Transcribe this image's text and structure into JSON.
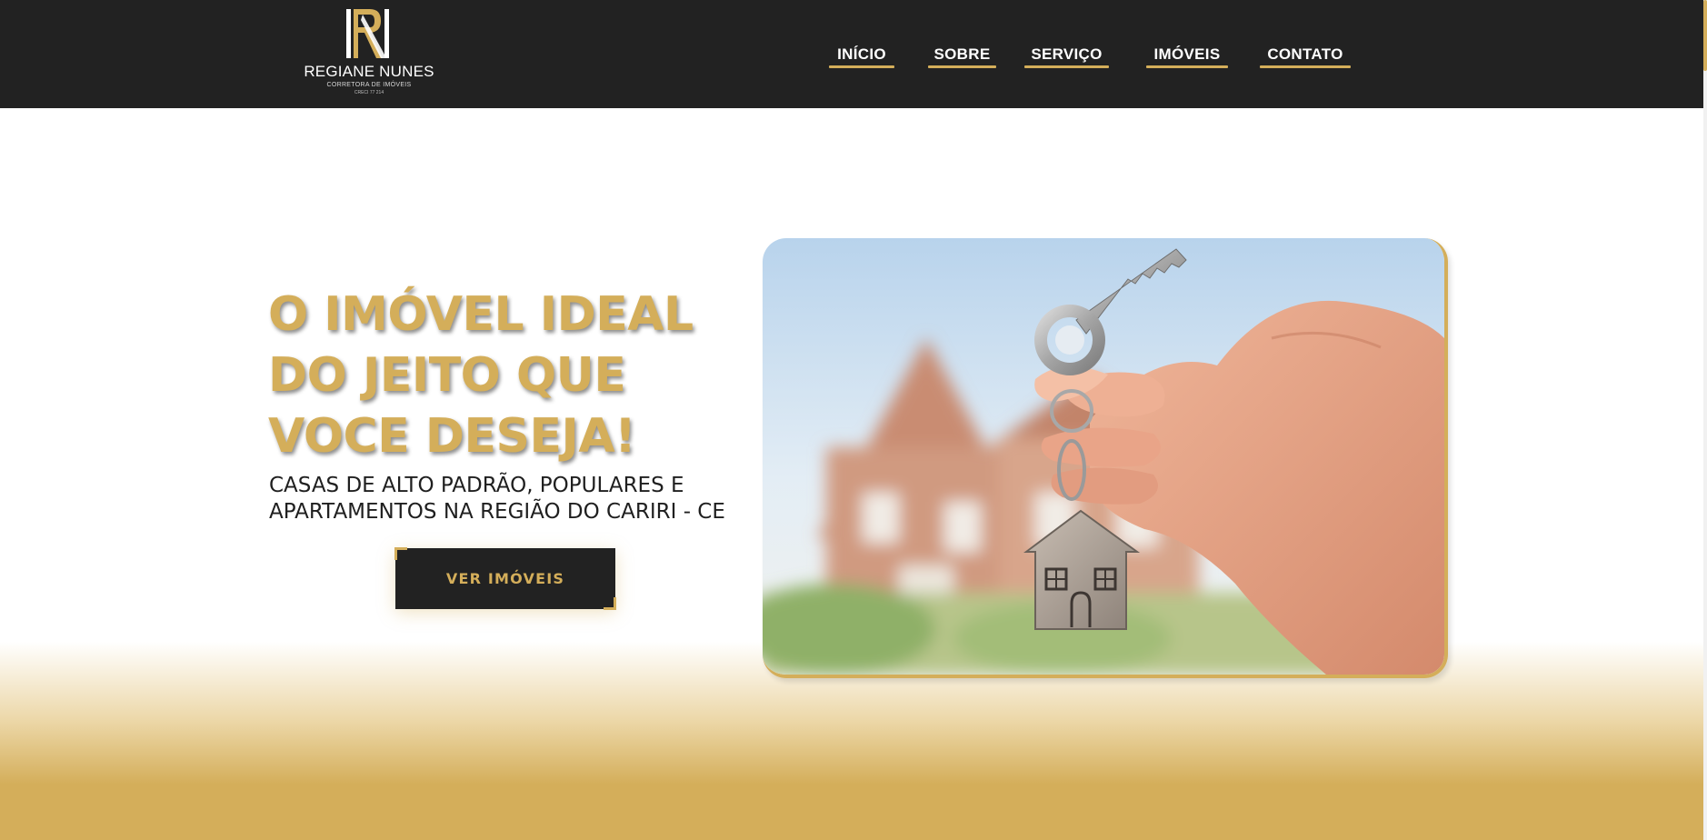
{
  "brand": {
    "name": "REGIANE NUNES",
    "subtitle": "CORRETORA DE IMÓVEIS",
    "creci": "CRECI 77 214"
  },
  "nav": {
    "items": [
      {
        "label": "INÍCIO"
      },
      {
        "label": "SOBRE"
      },
      {
        "label": "SERVIÇO"
      },
      {
        "label": "IMÓVEIS"
      },
      {
        "label": "CONTATO"
      }
    ]
  },
  "hero": {
    "title_lines": [
      "O IMÓVEL IDEAL",
      "DO JEITO QUE",
      "VOCE DESEJA!"
    ],
    "subtitle_lines": [
      "CASAS DE ALTO PADRÃO, POPULARES E",
      "APARTAMENTOS NA REGIÃO DO CARIRI - CE"
    ],
    "cta_label": "VER IMÓVEIS"
  },
  "colors": {
    "accent": "#d4ae5a",
    "dark": "#222222",
    "background": "#ffffff"
  },
  "icons": {
    "logo": "rn-monogram-logo",
    "hero": "hand-holding-house-key-photo"
  }
}
